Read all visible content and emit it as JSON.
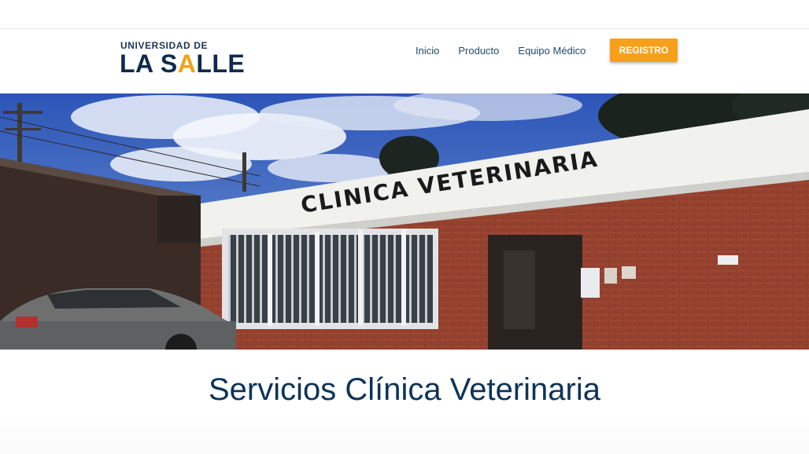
{
  "logo": {
    "top_text": "UNIVERSIDAD DE",
    "word_part1": "LA S",
    "word_accent": "A",
    "word_part2": "LLE"
  },
  "nav": {
    "items": [
      "Inicio",
      "Producto",
      "Equipo Médico"
    ],
    "cta": "REGISTRO"
  },
  "hero": {
    "sign_text": "CLINICA VETERINARIA"
  },
  "section": {
    "title": "Servicios Clínica Veterinaria"
  },
  "colors": {
    "brand_navy": "#0f2a4d",
    "accent_orange": "#f9a01b",
    "nav_link": "#244a6b"
  }
}
